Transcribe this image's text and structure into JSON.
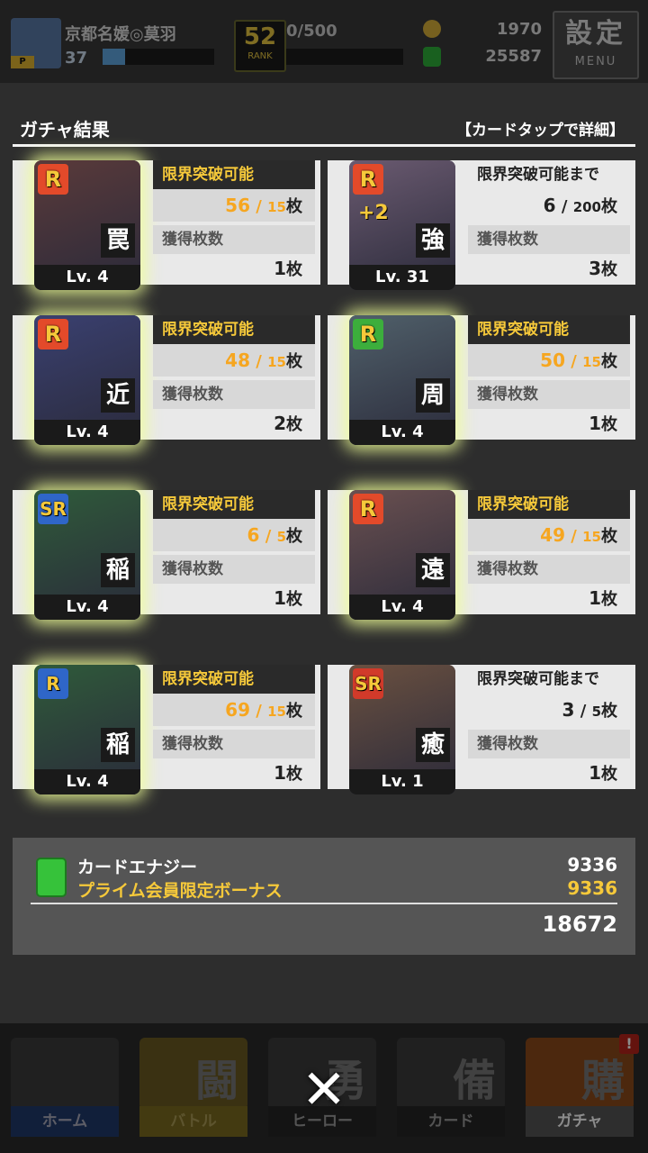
{
  "status_bar": {
    "player_name": "京都名媛◎莫羽",
    "player_level": "37",
    "xp_fraction": 0.2,
    "rank_number": "52",
    "rank_label": "RANK",
    "rank_progress": "0/500",
    "coins": "1970",
    "energy": "25587",
    "menu_big": "設定",
    "menu_small": "MENU"
  },
  "result": {
    "title": "ガチャ結果",
    "hint": "【カードタップで詳細】"
  },
  "cards": [
    {
      "rarity": "R",
      "rarity_style": "r",
      "kanji": "罠",
      "level": "Lv. 4",
      "status": "限界突破可能",
      "current": "56",
      "required": "15",
      "unit": "枚",
      "obtained_label": "獲得枚数",
      "obtained": "1",
      "glow": true,
      "plus": "",
      "art_color": "#5a3a3a",
      "highlight": true
    },
    {
      "rarity": "R",
      "rarity_style": "r",
      "kanji": "強",
      "level": "Lv. 31",
      "status": "限界突破可能まで",
      "current": "6",
      "required": "200",
      "unit": "枚",
      "obtained_label": "獲得枚数",
      "obtained": "3",
      "glow": false,
      "plus": "+2",
      "art_color": "#6a5a70",
      "highlight": false
    },
    {
      "rarity": "R",
      "rarity_style": "r",
      "kanji": "近",
      "level": "Lv. 4",
      "status": "限界突破可能",
      "current": "48",
      "required": "15",
      "unit": "枚",
      "obtained_label": "獲得枚数",
      "obtained": "2",
      "glow": true,
      "plus": "",
      "art_color": "#3a4070",
      "highlight": true
    },
    {
      "rarity": "R",
      "rarity_style": "rg",
      "kanji": "周",
      "level": "Lv. 4",
      "status": "限界突破可能",
      "current": "50",
      "required": "15",
      "unit": "枚",
      "obtained_label": "獲得枚数",
      "obtained": "1",
      "glow": true,
      "plus": "",
      "art_color": "#50606a",
      "highlight": true
    },
    {
      "rarity": "SR",
      "rarity_style": "sr",
      "kanji": "稲",
      "level": "Lv. 4",
      "status": "限界突破可能",
      "current": "6",
      "required": "5",
      "unit": "枚",
      "obtained_label": "獲得枚数",
      "obtained": "1",
      "glow": true,
      "plus": "",
      "art_color": "#2f5a3a",
      "highlight": true
    },
    {
      "rarity": "R",
      "rarity_style": "r",
      "kanji": "遠",
      "level": "Lv. 4",
      "status": "限界突破可能",
      "current": "49",
      "required": "15",
      "unit": "枚",
      "obtained_label": "獲得枚数",
      "obtained": "1",
      "glow": true,
      "plus": "",
      "art_color": "#6a5050",
      "highlight": true
    },
    {
      "rarity": "R",
      "rarity_style": "sr",
      "kanji": "稲",
      "level": "Lv. 4",
      "status": "限界突破可能",
      "current": "69",
      "required": "15",
      "unit": "枚",
      "obtained_label": "獲得枚数",
      "obtained": "1",
      "glow": true,
      "plus": "",
      "art_color": "#2f5a3a",
      "highlight": true
    },
    {
      "rarity": "SR",
      "rarity_style": "sr-red",
      "kanji": "癒",
      "level": "Lv. 1",
      "status": "限界突破可能まで",
      "current": "3",
      "required": "5",
      "unit": "枚",
      "obtained_label": "獲得枚数",
      "obtained": "1",
      "glow": false,
      "plus": "",
      "art_color": "#6a5040",
      "highlight": false
    }
  ],
  "energy_summary": {
    "label": "カードエナジー",
    "bonus_label": "プライム会員限定ボーナス",
    "base_value": "9336",
    "bonus_value": "9336",
    "total": "18672"
  },
  "nav": [
    {
      "label": "ホーム",
      "kanji": "",
      "style": "blue"
    },
    {
      "label": "バトル",
      "kanji": "闘",
      "style": "gold"
    },
    {
      "label": "ヒーロー",
      "kanji": "勇",
      "style": ""
    },
    {
      "label": "カード",
      "kanji": "備",
      "style": ""
    },
    {
      "label": "ガチャ",
      "kanji": "購",
      "style": "active",
      "badge": "!"
    }
  ],
  "close_label": "✕"
}
